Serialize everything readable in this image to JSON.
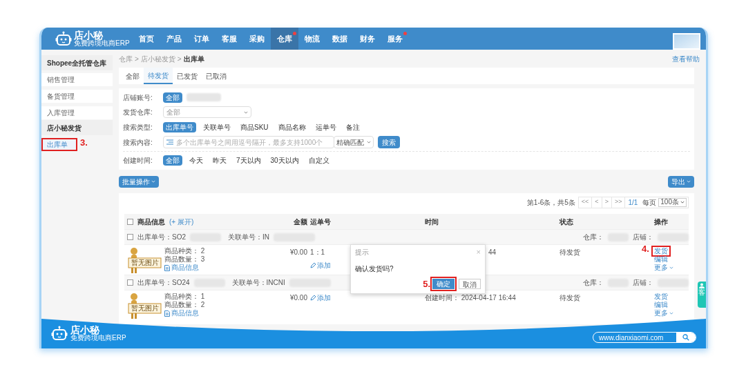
{
  "nav": {
    "logo": "店小秘",
    "tagline": "免费跨境电商ERP",
    "items": [
      {
        "label": "首页",
        "selected": false,
        "dot": false
      },
      {
        "label": "产品",
        "selected": false,
        "dot": false
      },
      {
        "label": "订单",
        "selected": false,
        "dot": false
      },
      {
        "label": "客服",
        "selected": false,
        "dot": false
      },
      {
        "label": "采购",
        "selected": false,
        "dot": false
      },
      {
        "label": "仓库",
        "selected": true,
        "dot": true
      },
      {
        "label": "物流",
        "selected": false,
        "dot": false
      },
      {
        "label": "数据",
        "selected": false,
        "dot": false
      },
      {
        "label": "财务",
        "selected": false,
        "dot": false
      },
      {
        "label": "服务",
        "selected": false,
        "dot": true
      }
    ]
  },
  "sidebar": [
    {
      "title": "Shopee全托管仓库",
      "items": [
        {
          "label": "销售管理",
          "selected": false
        },
        {
          "label": "备货管理",
          "selected": false
        },
        {
          "label": "入库管理",
          "selected": false
        }
      ]
    },
    {
      "title": "店小秘发货",
      "items": [
        {
          "label": "出库单",
          "selected": true,
          "annotation": "3."
        }
      ]
    }
  ],
  "breadcrumb": {
    "items": [
      "仓库",
      "店小秘发货",
      "出库单"
    ],
    "separator": ">"
  },
  "help_link": "查看帮助",
  "tabs": [
    {
      "label": "全部",
      "selected": false
    },
    {
      "label": "待发货",
      "selected": true
    },
    {
      "label": "已发货",
      "selected": false
    },
    {
      "label": "已取消",
      "selected": false
    }
  ],
  "filters": {
    "store": {
      "label": "店铺账号:",
      "options": [
        {
          "label": "全部",
          "selected": true
        }
      ]
    },
    "warehouse": {
      "label": "发货仓库:",
      "value": "全部"
    },
    "search_type": {
      "label": "搜索类型:",
      "options": [
        {
          "label": "出库单号",
          "selected": true
        },
        {
          "label": "关联单号",
          "selected": false
        },
        {
          "label": "商品SKU",
          "selected": false
        },
        {
          "label": "商品名称",
          "selected": false
        },
        {
          "label": "运单号",
          "selected": false
        },
        {
          "label": "备注",
          "selected": false
        }
      ]
    },
    "search": {
      "label": "搜索内容:",
      "placeholder": "多个出库单号之间用逗号隔开，最多支持1000个",
      "match": "精确匹配",
      "button": "搜索"
    },
    "created_time": {
      "label": "创建时间:",
      "options": [
        {
          "label": "全部",
          "selected": true
        },
        {
          "label": "今天",
          "selected": false
        },
        {
          "label": "昨天",
          "selected": false
        },
        {
          "label": "7天以内",
          "selected": false
        },
        {
          "label": "30天以内",
          "selected": false
        },
        {
          "label": "自定义",
          "selected": false
        }
      ]
    }
  },
  "batch_button": "批量操作",
  "export_button": "导出",
  "pagination": {
    "summary": "第1-6条，共5条",
    "buttons": [
      "<<",
      "<",
      ">",
      ">>"
    ],
    "page": "1/1",
    "per_page_label": "每页",
    "per_page": "100条"
  },
  "table": {
    "select_all_checked": false,
    "columns": [
      "商品信息",
      "金额",
      "运单号",
      "时间",
      "状态",
      "操作"
    ],
    "expand_link": "(+ 展开)",
    "orders": [
      {
        "checked": false,
        "order_no_label": "出库单号：",
        "order_no": "SO2",
        "ref_label": "关联单号：",
        "ref": "IN",
        "warehouse_label": "仓库：",
        "shop_label": "店铺：",
        "image_text": "暂无图片",
        "kinds_label": "商品种类：",
        "kinds": "2",
        "qty_label": "商品数量：",
        "qty": "3",
        "info_link": "商品信息",
        "amount": "¥0.00",
        "waybill": "1：1",
        "add_link": "添加",
        "time": "44",
        "status": "待发货",
        "actions": [
          {
            "label": "发货",
            "annotation": "4."
          },
          {
            "label": "编辑"
          },
          {
            "label": "更多"
          }
        ]
      },
      {
        "checked": false,
        "order_no_label": "出库单号：",
        "order_no": "SO24",
        "ref_label": "关联单号：",
        "ref": "INCNI",
        "warehouse_label": "仓库：",
        "shop_label": "店铺：",
        "image_text": "暂无图片",
        "kinds_label": "商品种类：",
        "kinds": "1",
        "qty_label": "商品数量：",
        "qty": "2",
        "info_link": "商品信息",
        "amount": "¥0.00",
        "add_link": "添加",
        "time": "创建时间：  2024-04-17 16:44",
        "status": "待发货",
        "actions": [
          {
            "label": "发货"
          },
          {
            "label": "编辑"
          },
          {
            "label": "更多"
          }
        ]
      }
    ]
  },
  "dialog": {
    "title": "提示",
    "close": "×",
    "message": "确认发货吗?",
    "confirm": "确定",
    "confirm_annotation": "5.",
    "cancel": "取消"
  },
  "side_tab": "客",
  "footer": {
    "logo": "店小秘",
    "tagline": "免费跨境电商ERP",
    "url": "www.dianxiaomi.com"
  }
}
